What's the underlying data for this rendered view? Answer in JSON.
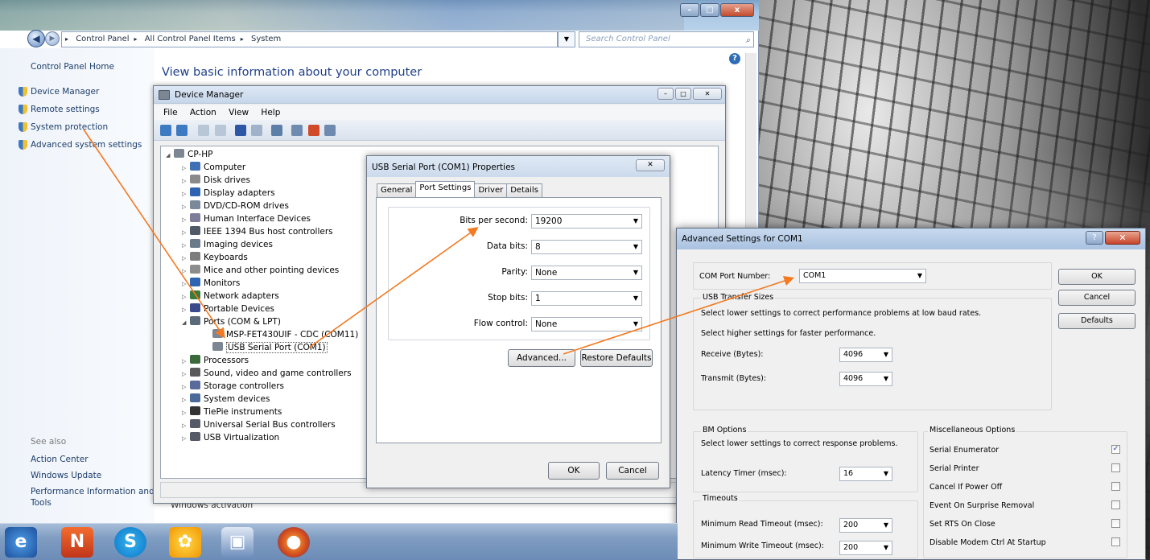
{
  "explorer": {
    "breadcrumb": [
      "Control Panel",
      "All Control Panel Items",
      "System"
    ],
    "search_placeholder": "Search Control Panel",
    "sidebar": {
      "home": "Control Panel Home",
      "items": [
        "Device Manager",
        "Remote settings",
        "System protection",
        "Advanced system settings"
      ],
      "see_also": "See also",
      "see_also_items": [
        "Action Center",
        "Windows Update",
        "Performance Information and",
        "Tools"
      ]
    },
    "main_heading": "View basic information about your computer",
    "windows_activation": "Windows activation",
    "icons": [
      "back-icon",
      "forward-icon",
      "search-icon",
      "help-icon"
    ]
  },
  "device_manager": {
    "title": "Device Manager",
    "menu": [
      "File",
      "Action",
      "View",
      "Help"
    ],
    "root": "CP-HP",
    "tree": [
      {
        "label": "Computer"
      },
      {
        "label": "Disk drives"
      },
      {
        "label": "Display adapters"
      },
      {
        "label": "DVD/CD-ROM drives"
      },
      {
        "label": "Human Interface Devices"
      },
      {
        "label": "IEEE 1394 Bus host controllers"
      },
      {
        "label": "Imaging devices"
      },
      {
        "label": "Keyboards"
      },
      {
        "label": "Mice and other pointing devices"
      },
      {
        "label": "Monitors"
      },
      {
        "label": "Network adapters"
      },
      {
        "label": "Portable Devices"
      },
      {
        "label": "Ports (COM & LPT)"
      },
      {
        "label": "MSP-FET430UIF - CDC (COM11)"
      },
      {
        "label": "USB Serial Port (COM1)"
      },
      {
        "label": "Processors"
      },
      {
        "label": "Sound, video and game controllers"
      },
      {
        "label": "Storage controllers"
      },
      {
        "label": "System devices"
      },
      {
        "label": "TiePie instruments"
      },
      {
        "label": "Universal Serial Bus controllers"
      },
      {
        "label": "USB Virtualization"
      }
    ]
  },
  "properties": {
    "title": "USB Serial Port (COM1) Properties",
    "tabs": [
      "General",
      "Port Settings",
      "Driver",
      "Details"
    ],
    "active_tab": "Port Settings",
    "fields": [
      {
        "label": "Bits per second:",
        "value": "19200"
      },
      {
        "label": "Data bits:",
        "value": "8"
      },
      {
        "label": "Parity:",
        "value": "None"
      },
      {
        "label": "Stop bits:",
        "value": "1"
      },
      {
        "label": "Flow control:",
        "value": "None"
      }
    ],
    "advanced_button": "Advanced...",
    "restore_button": "Restore Defaults",
    "ok": "OK",
    "cancel": "Cancel"
  },
  "advanced": {
    "title": "Advanced Settings for COM1",
    "com_port_label": "COM Port Number:",
    "com_port_value": "COM1",
    "ok": "OK",
    "cancel": "Cancel",
    "defaults": "Defaults",
    "usb_transfer": {
      "title": "USB Transfer Sizes",
      "line1": "Select lower settings to correct performance problems at low baud rates.",
      "line2": "Select higher settings for faster performance.",
      "receive_label": "Receive (Bytes):",
      "receive_value": "4096",
      "transmit_label": "Transmit (Bytes):",
      "transmit_value": "4096"
    },
    "bm": {
      "title": "BM Options",
      "desc": "Select lower settings to correct response problems.",
      "latency_label": "Latency Timer (msec):",
      "latency_value": "16"
    },
    "timeouts": {
      "title": "Timeouts",
      "read_label": "Minimum Read Timeout (msec):",
      "read_value": "200",
      "write_label": "Minimum Write Timeout (msec):",
      "write_value": "200"
    },
    "misc": {
      "title": "Miscellaneous Options",
      "options": [
        {
          "label": "Serial Enumerator",
          "checked": true
        },
        {
          "label": "Serial Printer",
          "checked": false
        },
        {
          "label": "Cancel If Power Off",
          "checked": false
        },
        {
          "label": "Event On Surprise Removal",
          "checked": false
        },
        {
          "label": "Set RTS On Close",
          "checked": false
        },
        {
          "label": "Disable Modem Ctrl At Startup",
          "checked": false
        }
      ]
    }
  },
  "taskbar": {
    "items": [
      "ie-icon",
      "office-icon",
      "skype-icon",
      "paint-icon",
      "network-icon",
      "firefox-icon"
    ]
  },
  "colors": {
    "arrow": "#f47920",
    "link": "#1c3d6a",
    "heading": "#1e3f87"
  }
}
